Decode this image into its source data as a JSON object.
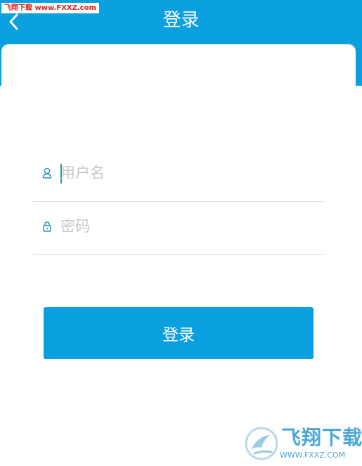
{
  "header": {
    "title": "登录",
    "back_icon": "chevron-left-icon",
    "background": "#0a9fdf"
  },
  "watermark_top": "飞翔下载 www.FXXZ.com",
  "form": {
    "username": {
      "placeholder": "用户名",
      "value": "",
      "icon": "user-icon"
    },
    "password": {
      "placeholder": "密码",
      "value": "",
      "icon": "lock-icon"
    }
  },
  "login_button": {
    "label": "登录",
    "color": "#0a9fdf"
  },
  "watermark_logo": {
    "text": "飞翔下载",
    "url": "WWW.FXXZ.COM"
  }
}
